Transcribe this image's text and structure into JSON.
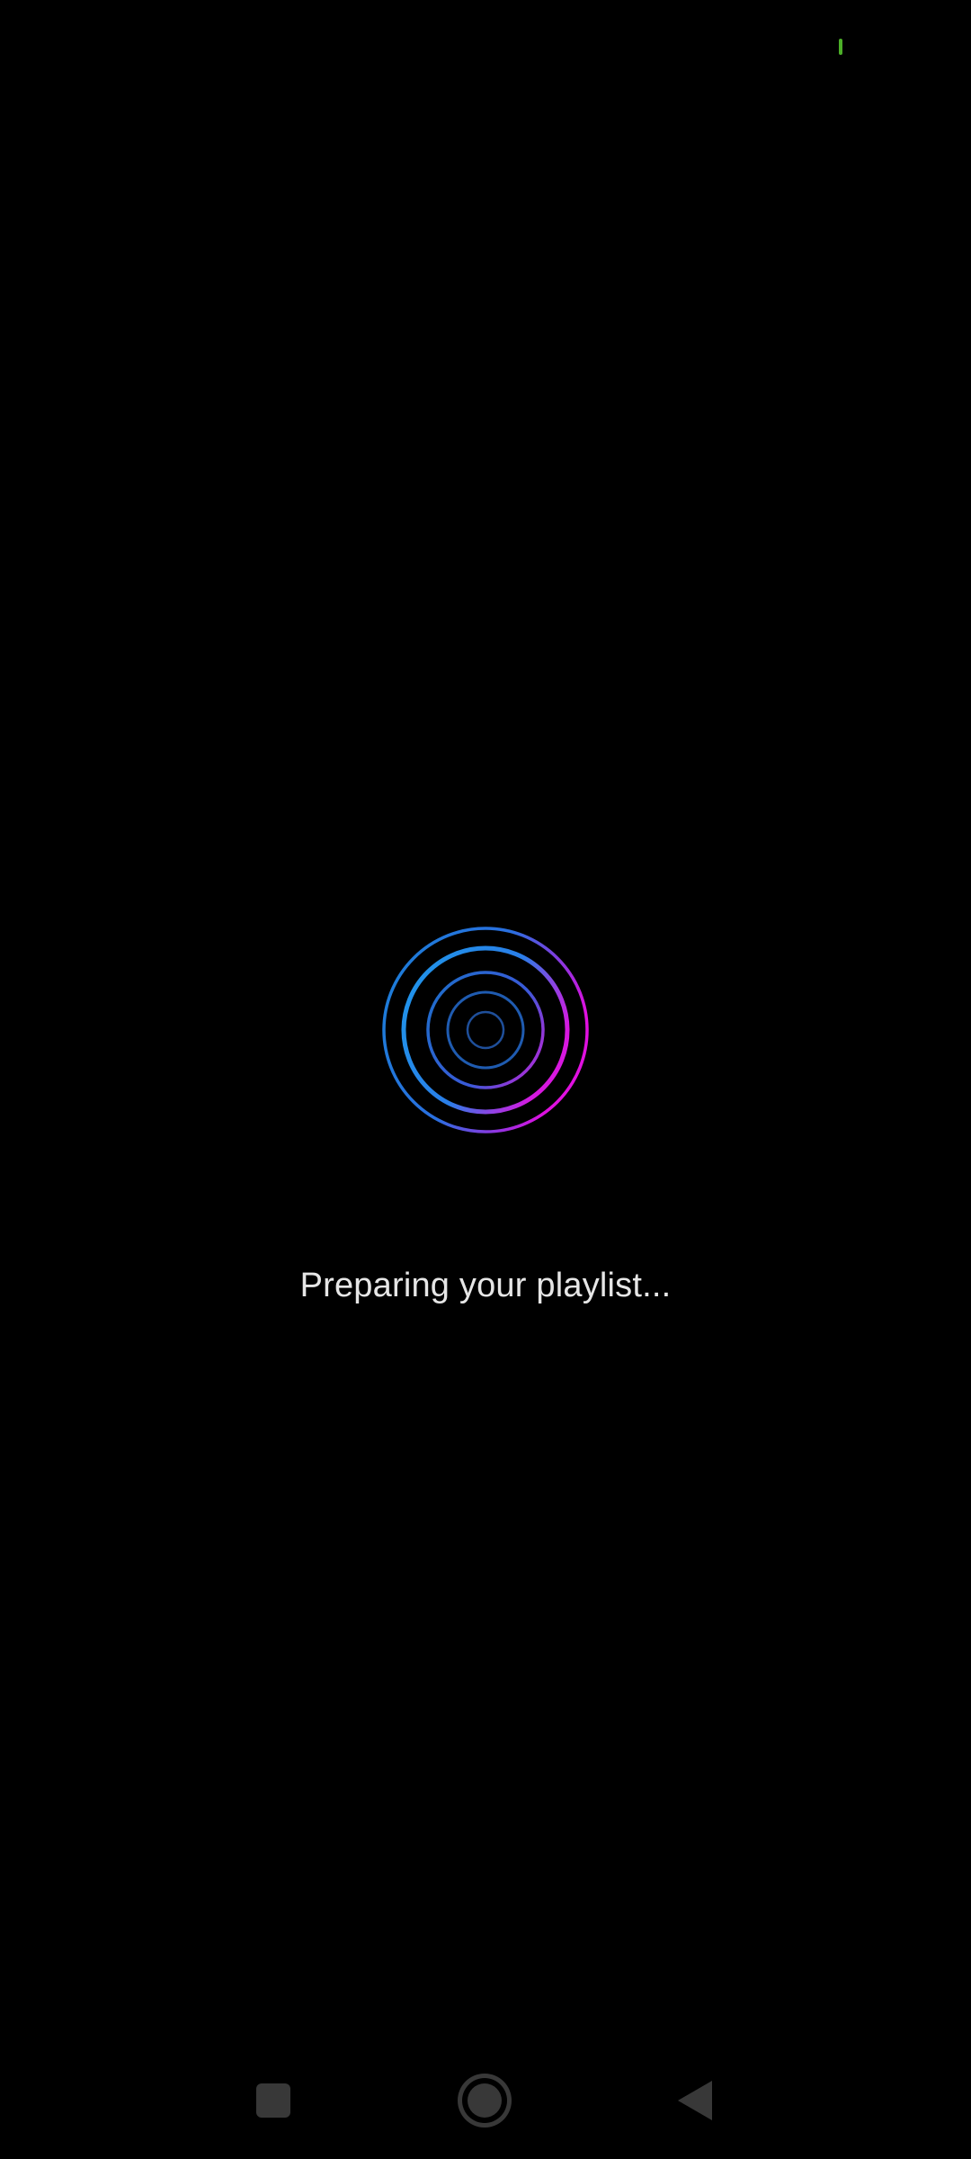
{
  "status": {
    "indicator_color": "#4caf28"
  },
  "loader": {
    "icon": "concentric-rings-icon",
    "gradient_start": "#1e90ff",
    "gradient_end": "#e010e0"
  },
  "message": "Preparing your playlist...",
  "navigation": {
    "recents_icon": "square-icon",
    "home_icon": "circle-icon",
    "back_icon": "triangle-back-icon",
    "icon_color": "#383838"
  }
}
